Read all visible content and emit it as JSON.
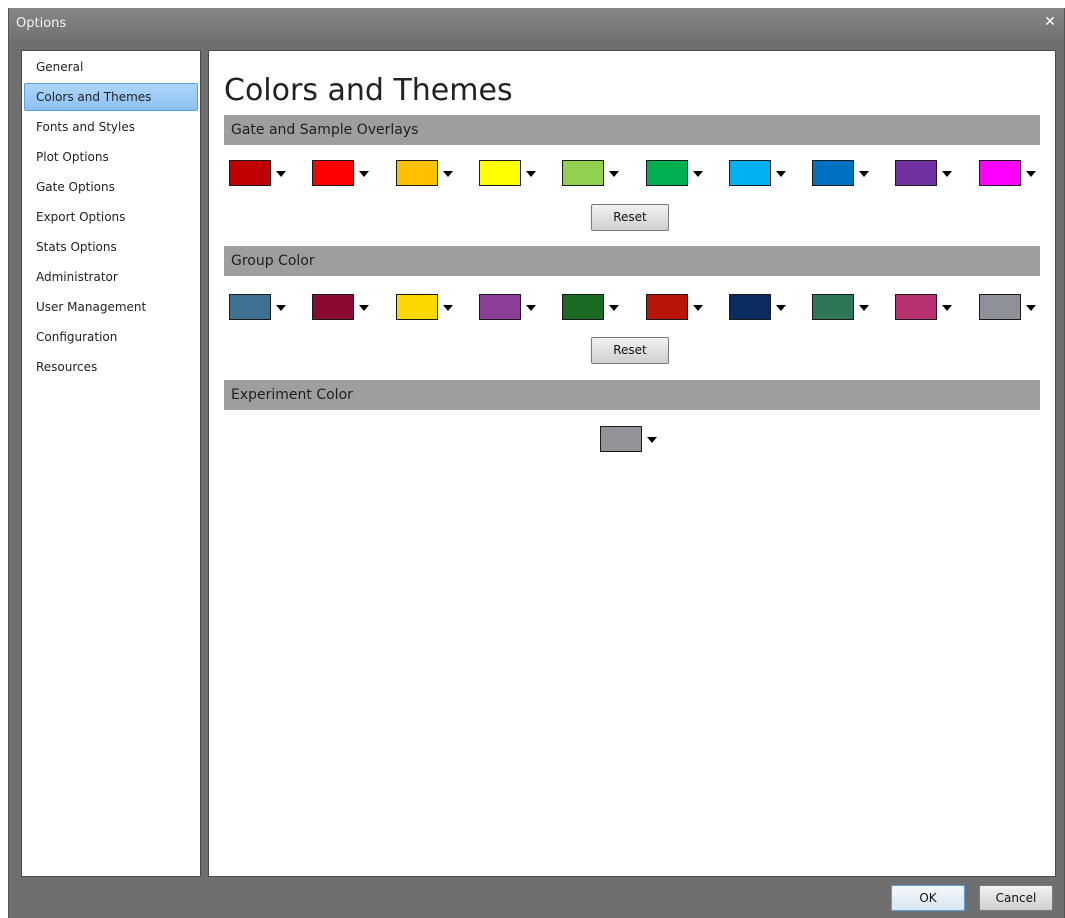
{
  "window": {
    "title": "Options",
    "close_icon": "close-icon"
  },
  "sidebar": {
    "selected_index": 1,
    "items": [
      {
        "label": "General"
      },
      {
        "label": "Colors and Themes"
      },
      {
        "label": "Fonts and Styles"
      },
      {
        "label": "Plot Options"
      },
      {
        "label": "Gate Options"
      },
      {
        "label": "Export Options"
      },
      {
        "label": "Stats Options"
      },
      {
        "label": "Administrator"
      },
      {
        "label": "User Management"
      },
      {
        "label": "Configuration"
      },
      {
        "label": "Resources"
      }
    ]
  },
  "main": {
    "title": "Colors and Themes",
    "gate_overlays": {
      "header": "Gate and Sample Overlays",
      "colors": [
        "#c00000",
        "#ff0000",
        "#ffc000",
        "#ffff00",
        "#92d050",
        "#00b050",
        "#00b0f0",
        "#0070c0",
        "#7030a0",
        "#ff00ff"
      ],
      "reset_label": "Reset"
    },
    "group_color": {
      "header": "Group Color",
      "colors": [
        "#3f7193",
        "#8b0a32",
        "#ffd700",
        "#8c3f96",
        "#1b6b23",
        "#b81408",
        "#0c2b5e",
        "#2e7656",
        "#b83272",
        "#8f9198"
      ],
      "reset_label": "Reset"
    },
    "experiment_color": {
      "header": "Experiment Color",
      "color": "#929298"
    }
  },
  "footer": {
    "ok_label": "OK",
    "cancel_label": "Cancel"
  }
}
